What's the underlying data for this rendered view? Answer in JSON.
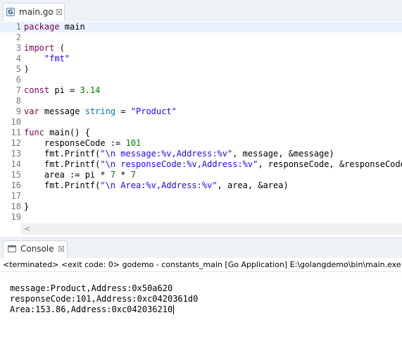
{
  "editor": {
    "tab": {
      "label": "main.go",
      "icon": "go-file-icon",
      "close": "☒"
    },
    "current_line": 1,
    "lines": [
      {
        "n": "1",
        "tokens": [
          {
            "t": "package",
            "c": "kw"
          },
          {
            "t": " main",
            "c": ""
          }
        ]
      },
      {
        "n": "2",
        "tokens": []
      },
      {
        "n": "3",
        "tokens": [
          {
            "t": "import",
            "c": "kw"
          },
          {
            "t": " (",
            "c": ""
          }
        ]
      },
      {
        "n": "4",
        "tokens": [
          {
            "t": "    ",
            "c": ""
          },
          {
            "t": "\"fmt\"",
            "c": "str"
          }
        ]
      },
      {
        "n": "5",
        "tokens": [
          {
            "t": ")",
            "c": ""
          }
        ]
      },
      {
        "n": "6",
        "tokens": []
      },
      {
        "n": "7",
        "tokens": [
          {
            "t": "const",
            "c": "kw"
          },
          {
            "t": " pi = ",
            "c": ""
          },
          {
            "t": "3.14",
            "c": "num"
          }
        ]
      },
      {
        "n": "8",
        "tokens": []
      },
      {
        "n": "9",
        "tokens": [
          {
            "t": "var",
            "c": "kw"
          },
          {
            "t": " message ",
            "c": ""
          },
          {
            "t": "string",
            "c": "typ"
          },
          {
            "t": " = ",
            "c": ""
          },
          {
            "t": "\"Product\"",
            "c": "str"
          }
        ]
      },
      {
        "n": "10",
        "tokens": []
      },
      {
        "n": "11",
        "tokens": [
          {
            "t": "func",
            "c": "kw"
          },
          {
            "t": " main() {",
            "c": ""
          }
        ]
      },
      {
        "n": "12",
        "tokens": [
          {
            "t": "    responseCode := ",
            "c": ""
          },
          {
            "t": "101",
            "c": "num"
          }
        ]
      },
      {
        "n": "13",
        "tokens": [
          {
            "t": "    fmt.Printf(",
            "c": ""
          },
          {
            "t": "\"\\n message:%v,Address:%v\"",
            "c": "str"
          },
          {
            "t": ", message, &message)",
            "c": ""
          }
        ]
      },
      {
        "n": "14",
        "tokens": [
          {
            "t": "    fmt.Printf(",
            "c": ""
          },
          {
            "t": "\"\\n responseCode:%v,Address:%v\"",
            "c": "str"
          },
          {
            "t": ", responseCode, &responseCode)",
            "c": ""
          }
        ]
      },
      {
        "n": "15",
        "tokens": [
          {
            "t": "    area := pi * ",
            "c": ""
          },
          {
            "t": "7",
            "c": "num"
          },
          {
            "t": " * ",
            "c": ""
          },
          {
            "t": "7",
            "c": "num"
          }
        ]
      },
      {
        "n": "16",
        "tokens": [
          {
            "t": "    fmt.Printf(",
            "c": ""
          },
          {
            "t": "\"\\n Area:%v,Address:%v\"",
            "c": "str"
          },
          {
            "t": ", area, &area)",
            "c": ""
          }
        ]
      },
      {
        "n": "17",
        "tokens": []
      },
      {
        "n": "18",
        "tokens": [
          {
            "t": "}",
            "c": ""
          }
        ]
      },
      {
        "n": "19",
        "tokens": []
      }
    ],
    "scroll_arrow": "<"
  },
  "console": {
    "tab": {
      "label": "Console",
      "icon": "console-icon",
      "close": "☒"
    },
    "status": "<terminated> <exit code: 0> godemo - constants_main [Go Application] E:\\golangdemo\\bin\\main.exe (Jul",
    "output": [
      "message:Product,Address:0x50a620",
      "responseCode:101,Address:0xc0420361d0",
      "Area:153.86,Address:0xc042036210"
    ]
  },
  "colors": {
    "keyword": "#7f0055",
    "string": "#2a00ff",
    "number": "#008000",
    "type": "#0072b2",
    "current_line_bg": "#e8f2fe"
  }
}
